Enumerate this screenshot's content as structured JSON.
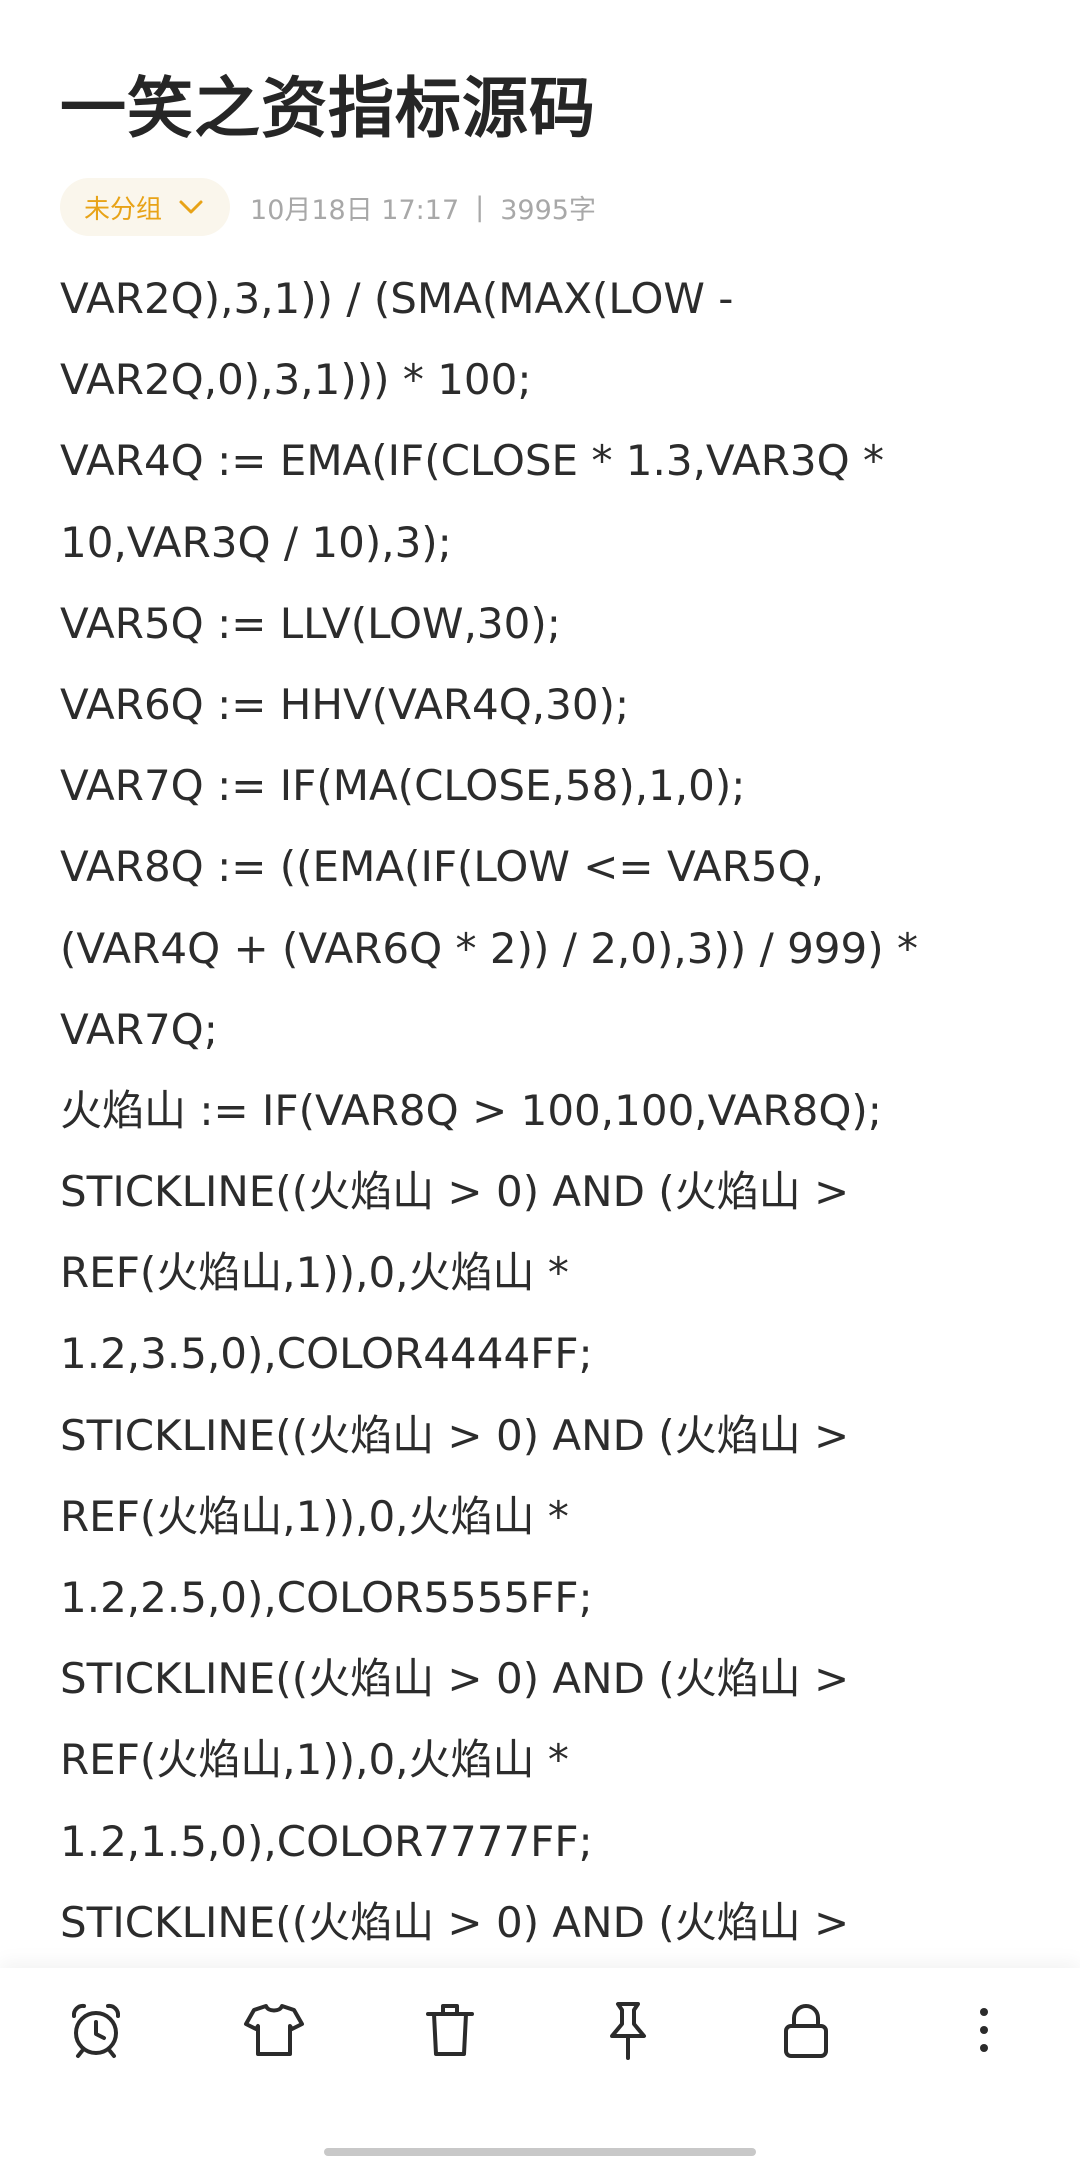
{
  "note": {
    "title": "一笑之资指标源码",
    "group_label": "未分组",
    "date": "10月18日 17:17",
    "separator": "|",
    "word_count": "3995字",
    "lines": [
      "VAR2Q),3,1)) / (SMA(MAX(LOW -",
      "VAR2Q,0),3,1))) * 100;",
      "VAR4Q := EMA(IF(CLOSE * 1.3,VAR3Q *",
      "10,VAR3Q / 10),3);",
      "VAR5Q := LLV(LOW,30);",
      "VAR6Q := HHV(VAR4Q,30);",
      "VAR7Q := IF(MA(CLOSE,58),1,0);",
      "VAR8Q := ((EMA(IF(LOW <= VAR5Q,",
      "(VAR4Q + (VAR6Q * 2)) / 2,0),3)) / 999) *",
      "VAR7Q;",
      "火焰山 := IF(VAR8Q > 100,100,VAR8Q);",
      "STICKLINE((火焰山 > 0) AND (火焰山 >",
      "REF(火焰山,1)),0,火焰山 *",
      "1.2,3.5,0),COLOR4444FF;",
      "STICKLINE((火焰山 > 0) AND (火焰山 >",
      "REF(火焰山,1)),0,火焰山 *",
      "1.2,2.5,0),COLOR5555FF;",
      "STICKLINE((火焰山 > 0) AND (火焰山 >",
      "REF(火焰山,1)),0,火焰山 *",
      "1.2,1.5,0),COLOR7777FF;",
      "STICKLINE((火焰山 > 0) AND (火焰山 >"
    ]
  },
  "toolbar": {
    "items": [
      {
        "icon": "alarm-clock-icon"
      },
      {
        "icon": "tshirt-icon"
      },
      {
        "icon": "trash-icon"
      },
      {
        "icon": "pin-icon"
      },
      {
        "icon": "lock-icon"
      },
      {
        "icon": "more-vertical-icon"
      }
    ]
  },
  "colors": {
    "accent": "#e8a317",
    "chip_background": "#faf6ec",
    "meta_text": "#a8a8a8",
    "body_text": "#2c2c2c"
  }
}
